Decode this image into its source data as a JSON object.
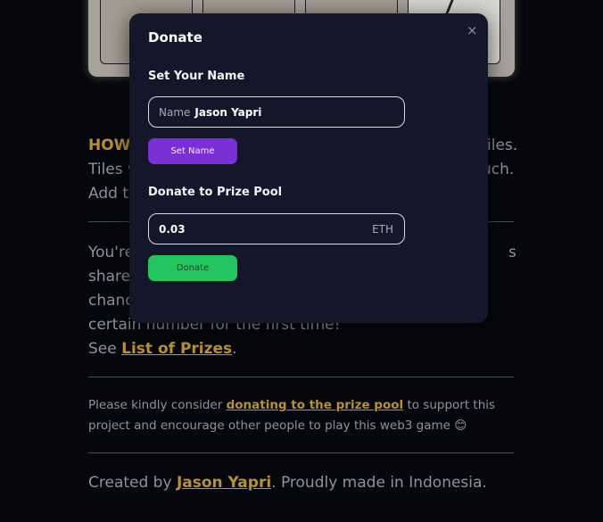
{
  "background": {
    "how_to": {
      "title": "HOW T",
      "line1_end": "iles.",
      "line2_start": "Tiles w",
      "line2_end": "uch.",
      "line3_start": "Add th"
    },
    "prize": {
      "line1_start": "You're",
      "line1_end": "s",
      "line2_start": "shared",
      "line3_start": "chanc",
      "line4": "certain number for the first time!",
      "see_prefix": "See ",
      "see_link": "List of Prizes",
      "see_suffix": "."
    },
    "donate_note": {
      "prefix": "Please kindly consider ",
      "link": "donating to the prize pool",
      "suffix": " to support this project and encourage other people to play this web3 game ",
      "emoji": "😊"
    },
    "footer": {
      "prefix": "Created by ",
      "link": "Jason Yapri",
      "suffix": ". Proudly made in Indonesia."
    }
  },
  "modal": {
    "title": "Donate",
    "close_icon": "×",
    "name_section": {
      "label": "Set Your Name",
      "input_prefix": "Name",
      "input_value": "Jason Yapri",
      "button": "Set Name"
    },
    "donate_section": {
      "label": "Donate to Prize Pool",
      "input_value": "0.03",
      "input_suffix": "ETH",
      "button": "Donate"
    }
  },
  "colors": {
    "accent_gold": "#b8922c",
    "purple_button": "#7b2fd6",
    "green_button": "#22c55e",
    "modal_bg": "#131729"
  }
}
